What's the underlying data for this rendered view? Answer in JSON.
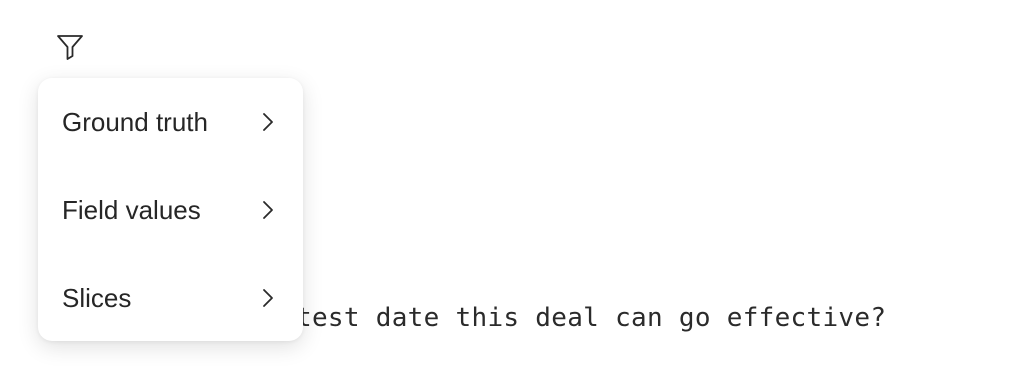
{
  "toolbar": {
    "filter_icon": "filter-funnel-icon"
  },
  "menu": {
    "items": [
      {
        "label": "Ground truth",
        "icon": "chevron-right-icon"
      },
      {
        "label": "Field values",
        "icon": "chevron-right-icon"
      },
      {
        "label": "Slices",
        "icon": "chevron-right-icon"
      }
    ]
  },
  "background": {
    "question_fragment": "test date this deal can go effective?"
  },
  "colors": {
    "text": "#262626",
    "menu_bg": "#ffffff",
    "page_bg": "#ffffff"
  }
}
